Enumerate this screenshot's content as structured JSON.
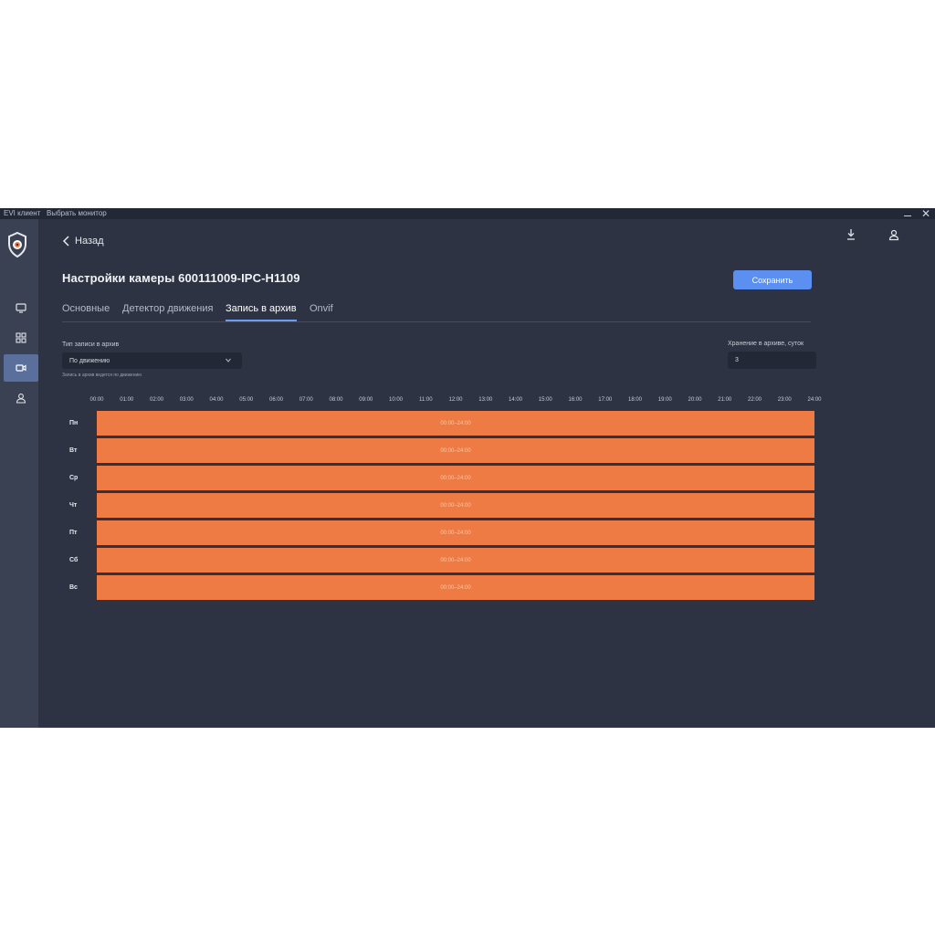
{
  "titlebar": {
    "app_name": "EVI клиент",
    "monitor_menu": "Выбрать монитор",
    "close_glyph": "✕"
  },
  "nav": {
    "back_label": "Назад",
    "page_title": "Настройки камеры 600111009-IPC-H1109",
    "save_label": "Сохранить"
  },
  "sidebar": {
    "items": [
      {
        "icon": "monitor-icon"
      },
      {
        "icon": "grid-icon"
      },
      {
        "icon": "camera-icon",
        "active": true
      },
      {
        "icon": "user-icon"
      }
    ]
  },
  "header_icons": [
    "download-icon",
    "user-icon"
  ],
  "tabs": [
    {
      "label": "Основные"
    },
    {
      "label": "Детектор движения"
    },
    {
      "label": "Запись в архив",
      "active": true
    },
    {
      "label": "Onvif"
    }
  ],
  "form": {
    "record_type_label": "Тип записи в архив",
    "record_type_value": "По движению",
    "record_type_hint": "Запись в архив ведется по движению",
    "retention_label": "Хранение в архиве, суток",
    "retention_value": "3"
  },
  "schedule": {
    "hours": [
      "00:00",
      "01:00",
      "02:00",
      "03:00",
      "04:00",
      "05:00",
      "06:00",
      "07:00",
      "08:00",
      "09:00",
      "10:00",
      "11:00",
      "12:00",
      "13:00",
      "14:00",
      "15:00",
      "16:00",
      "17:00",
      "18:00",
      "19:00",
      "20:00",
      "21:00",
      "22:00",
      "23:00",
      "24:00"
    ],
    "days": [
      {
        "label": "Пн",
        "range": "00:00–24:00"
      },
      {
        "label": "Вт",
        "range": "00:00–24:00"
      },
      {
        "label": "Ср",
        "range": "00:00–24:00"
      },
      {
        "label": "Чт",
        "range": "00:00–24:00"
      },
      {
        "label": "Пт",
        "range": "00:00–24:00"
      },
      {
        "label": "Сб",
        "range": "00:00–24:00"
      },
      {
        "label": "Вс",
        "range": "00:00–24:00"
      }
    ],
    "bar_color": "#ee7b43"
  },
  "colors": {
    "accent": "#5b8ff0",
    "background": "#2d3343",
    "sidebar": "#3a4152"
  }
}
